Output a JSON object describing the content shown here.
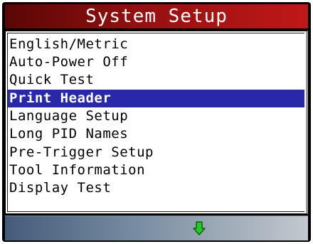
{
  "title": "System Setup",
  "menu": {
    "selected_index": 3,
    "items": [
      {
        "label": "English/Metric"
      },
      {
        "label": "Auto-Power Off"
      },
      {
        "label": "Quick Test"
      },
      {
        "label": "Print Header"
      },
      {
        "label": "Language Setup"
      },
      {
        "label": "Long PID Names"
      },
      {
        "label": "Pre-Trigger Setup"
      },
      {
        "label": "Tool Information"
      },
      {
        "label": "Display Test"
      }
    ]
  },
  "status_bar": {
    "icon": "down-arrow-icon",
    "icon_color": "#22cc22"
  },
  "colors": {
    "title_bar": "#951010",
    "selection": "#2828a8"
  }
}
